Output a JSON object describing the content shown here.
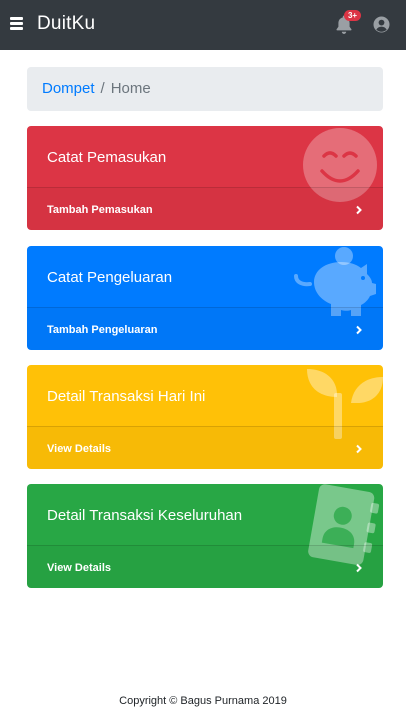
{
  "navbar": {
    "brand": "DuitKu",
    "notification_count": "3+",
    "icons": [
      "menu-icon",
      "bell-icon",
      "user-circle-icon"
    ]
  },
  "breadcrumb": {
    "link": "Dompet",
    "separator": "/",
    "current": "Home"
  },
  "cards": [
    {
      "title": "Catat Pemasukan",
      "footer": "Tambah Pemasukan",
      "color": "#dc3545",
      "icon": "smile-icon"
    },
    {
      "title": "Catat Pengeluaran",
      "footer": "Tambah Pengeluaran",
      "color": "#007bff",
      "icon": "piggy-bank-icon"
    },
    {
      "title": "Detail Transaksi Hari Ini",
      "footer": "View Details",
      "color": "#ffc107",
      "icon": "seedling-icon"
    },
    {
      "title": "Detail Transaksi Keseluruhan",
      "footer": "View Details",
      "color": "#28a745",
      "icon": "address-book-icon"
    }
  ],
  "footer": {
    "copyright": "Copyright © Bagus Purnama 2019"
  }
}
